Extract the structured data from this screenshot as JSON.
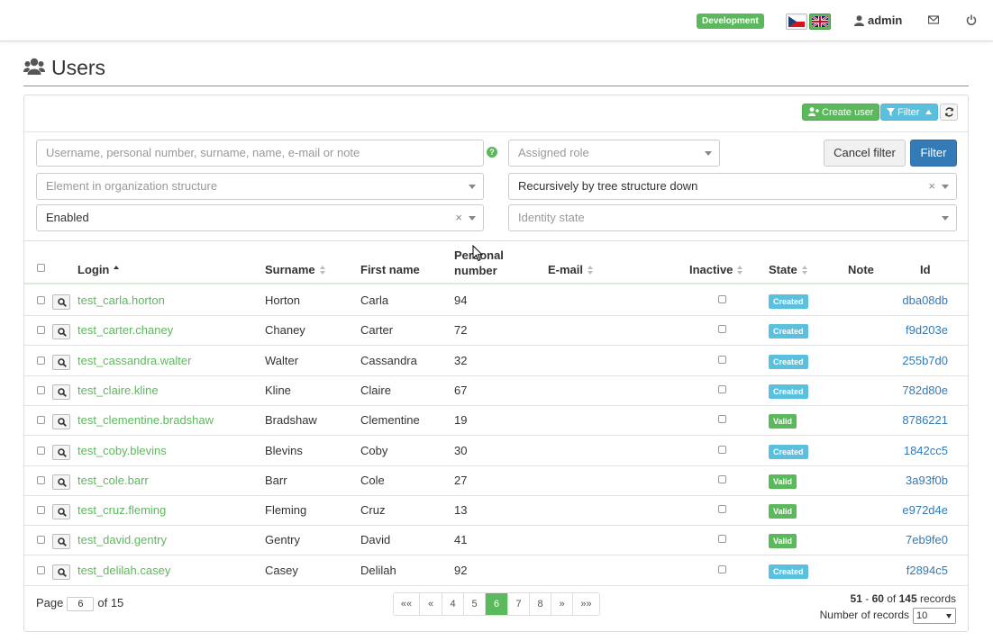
{
  "topbar": {
    "environment": "Development",
    "languages": [
      {
        "code": "cs",
        "icon": "czech-flag-icon"
      },
      {
        "code": "en",
        "icon": "uk-flag-icon",
        "active": true
      }
    ],
    "username": "admin",
    "icons": [
      "user-icon",
      "envelope-icon",
      "power-icon"
    ]
  },
  "page": {
    "title": "Users",
    "icon": "users-icon"
  },
  "toolbar": {
    "create_label": "Create user",
    "filter_label": "Filter",
    "refresh_icon": "refresh-icon"
  },
  "filter": {
    "text_placeholder": "Username, personal number, surname, name, e-mail or note",
    "role_placeholder": "Assigned role",
    "org_placeholder": "Element in organization structure",
    "recursion_value": "Recursively by tree structure down",
    "enabled_value": "Enabled",
    "identity_state_placeholder": "Identity state",
    "cancel_label": "Cancel filter",
    "apply_label": "Filter",
    "help_icon": "question-icon"
  },
  "table": {
    "columns": {
      "login": "Login",
      "surname": "Surname",
      "first_name": "First name",
      "personal_number": "Personal number",
      "email": "E-mail",
      "inactive": "Inactive",
      "state": "State",
      "note": "Note",
      "id": "Id"
    },
    "rows": [
      {
        "login": "test_carla.horton",
        "surname": "Horton",
        "first_name": "Carla",
        "personal_number": "94",
        "email": "",
        "state": "Created",
        "id": "dba08db"
      },
      {
        "login": "test_carter.chaney",
        "surname": "Chaney",
        "first_name": "Carter",
        "personal_number": "72",
        "email": "",
        "state": "Created",
        "id": "f9d203e"
      },
      {
        "login": "test_cassandra.walter",
        "surname": "Walter",
        "first_name": "Cassandra",
        "personal_number": "32",
        "email": "",
        "state": "Created",
        "id": "255b7d0"
      },
      {
        "login": "test_claire.kline",
        "surname": "Kline",
        "first_name": "Claire",
        "personal_number": "67",
        "email": "",
        "state": "Created",
        "id": "782d80e"
      },
      {
        "login": "test_clementine.bradshaw",
        "surname": "Bradshaw",
        "first_name": "Clementine",
        "personal_number": "19",
        "email": "",
        "state": "Valid",
        "id": "8786221"
      },
      {
        "login": "test_coby.blevins",
        "surname": "Blevins",
        "first_name": "Coby",
        "personal_number": "30",
        "email": "",
        "state": "Created",
        "id": "1842cc5"
      },
      {
        "login": "test_cole.barr",
        "surname": "Barr",
        "first_name": "Cole",
        "personal_number": "27",
        "email": "",
        "state": "Valid",
        "id": "3a93f0b"
      },
      {
        "login": "test_cruz.fleming",
        "surname": "Fleming",
        "first_name": "Cruz",
        "personal_number": "13",
        "email": "",
        "state": "Valid",
        "id": "e972d4e"
      },
      {
        "login": "test_david.gentry",
        "surname": "Gentry",
        "first_name": "David",
        "personal_number": "41",
        "email": "",
        "state": "Valid",
        "id": "7eb9fe0"
      },
      {
        "login": "test_delilah.casey",
        "surname": "Casey",
        "first_name": "Delilah",
        "personal_number": "92",
        "email": "",
        "state": "Created",
        "id": "f2894c5"
      }
    ]
  },
  "pagination": {
    "page_label": "Page",
    "current_page": "6",
    "of_label": "of 15",
    "buttons": [
      "«« ",
      "«",
      "4",
      "5",
      "6",
      "7",
      "8",
      "»",
      "»»"
    ],
    "records_from": "51",
    "records_to": "60",
    "records_total": "145",
    "records_suffix": "records",
    "page_size_label": "Number of records",
    "page_size": "10"
  },
  "colors": {
    "primary": "#337ab7",
    "success": "#5cb85c",
    "info": "#5bc0de"
  }
}
